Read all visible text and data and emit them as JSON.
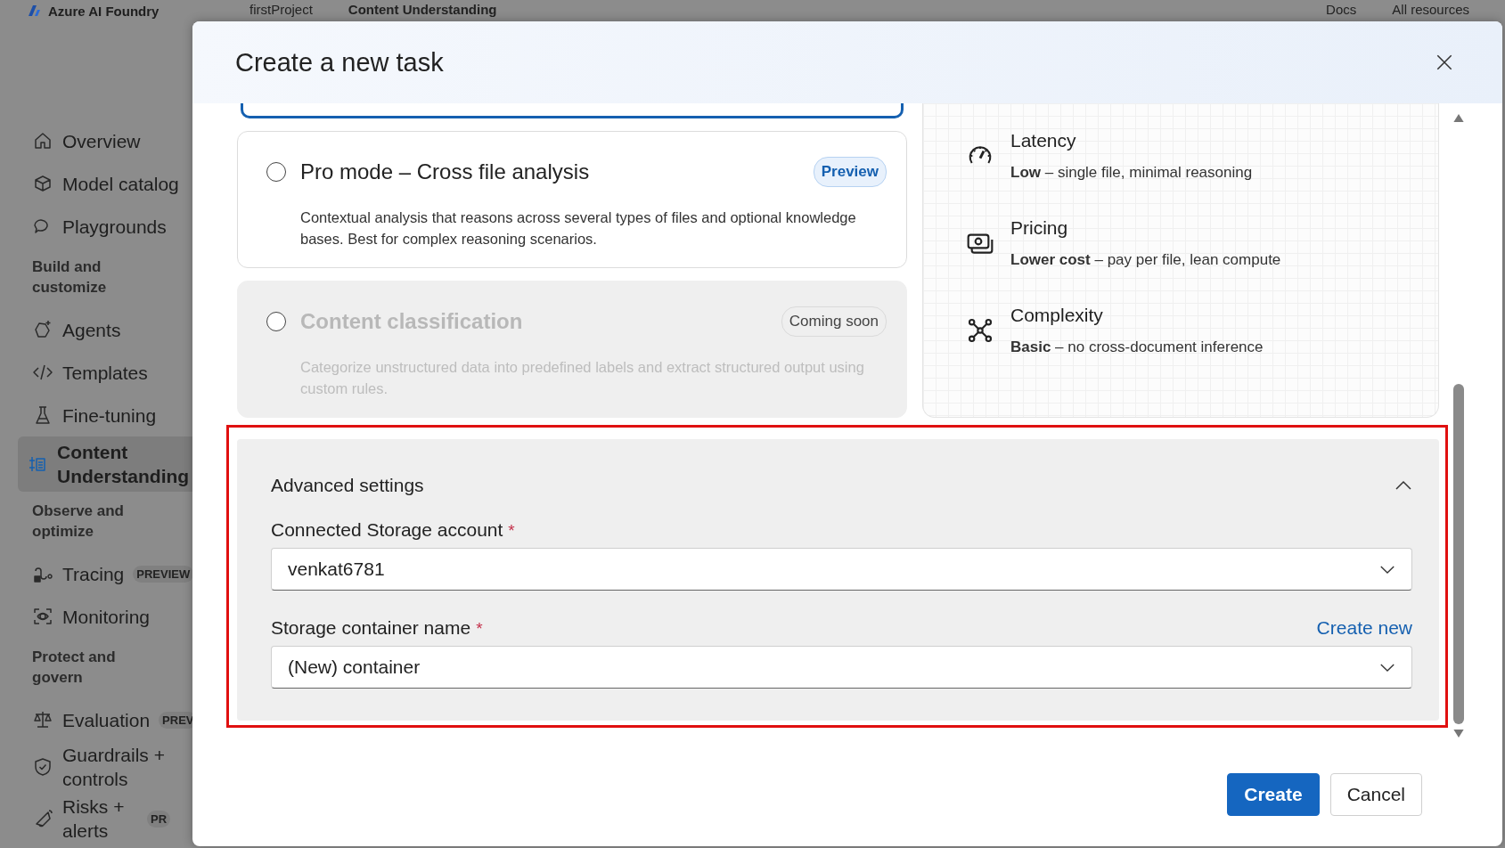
{
  "top_bar": {
    "brand": "Azure AI Foundry",
    "breadcrumbs": [
      "firstProject",
      "Content Understanding"
    ],
    "links": [
      "Docs",
      "All resources"
    ]
  },
  "sidebar": {
    "items": [
      {
        "kind": "item",
        "label": "Overview",
        "selected": false
      },
      {
        "kind": "item",
        "label": "Model catalog",
        "selected": false
      },
      {
        "kind": "item",
        "label": "Playgrounds",
        "selected": false
      },
      {
        "kind": "section",
        "label": "Build and customize"
      },
      {
        "kind": "item",
        "label": "Agents",
        "selected": false
      },
      {
        "kind": "item",
        "label": "Templates",
        "selected": false
      },
      {
        "kind": "item",
        "label": "Fine-tuning",
        "selected": false
      },
      {
        "kind": "item",
        "label": "Content Understanding",
        "selected": true
      },
      {
        "kind": "section",
        "label": "Observe and optimize"
      },
      {
        "kind": "item",
        "label": "Tracing",
        "badge": "PREVIEW",
        "selected": false
      },
      {
        "kind": "item",
        "label": "Monitoring",
        "selected": false
      },
      {
        "kind": "section",
        "label": "Protect and govern"
      },
      {
        "kind": "item",
        "label": "Evaluation",
        "badge": "PREV",
        "selected": false
      },
      {
        "kind": "item",
        "label": "Guardrails + controls",
        "selected": false
      },
      {
        "kind": "item",
        "label": "Risks + alerts",
        "badge": "PR",
        "selected": false
      }
    ]
  },
  "dialog": {
    "title": "Create a new task",
    "options": [
      {
        "title": "Pro mode – Cross file analysis",
        "badge": "Preview",
        "description": "Contextual analysis that reasons across several types of files and optional knowledge bases. Best for complex reasoning scenarios.",
        "selected": false,
        "disabled": false
      },
      {
        "title": "Content classification",
        "badge": "Coming soon",
        "description": "Categorize unstructured data into predefined labels and extract structured output using custom rules.",
        "selected": false,
        "disabled": true
      }
    ],
    "details": [
      {
        "title": "Latency",
        "text": "**Low** – single file, minimal reasoning"
      },
      {
        "title": "Pricing",
        "text": "**Lower cost** – pay per file, lean compute"
      },
      {
        "title": "Complexity",
        "text": "**Basic** – no cross-document inference"
      }
    ],
    "advanced": {
      "title": "Advanced settings",
      "expanded": true,
      "fields": [
        {
          "label": "Connected Storage account",
          "required_mark": "*",
          "value": "venkat6781"
        },
        {
          "label": "Storage container name",
          "required_mark": "*",
          "value": "(New) container",
          "link": "Create new"
        }
      ]
    },
    "buttons": [
      {
        "label": "Create",
        "kind": "primary"
      },
      {
        "label": "Cancel",
        "kind": "secondary"
      }
    ]
  }
}
